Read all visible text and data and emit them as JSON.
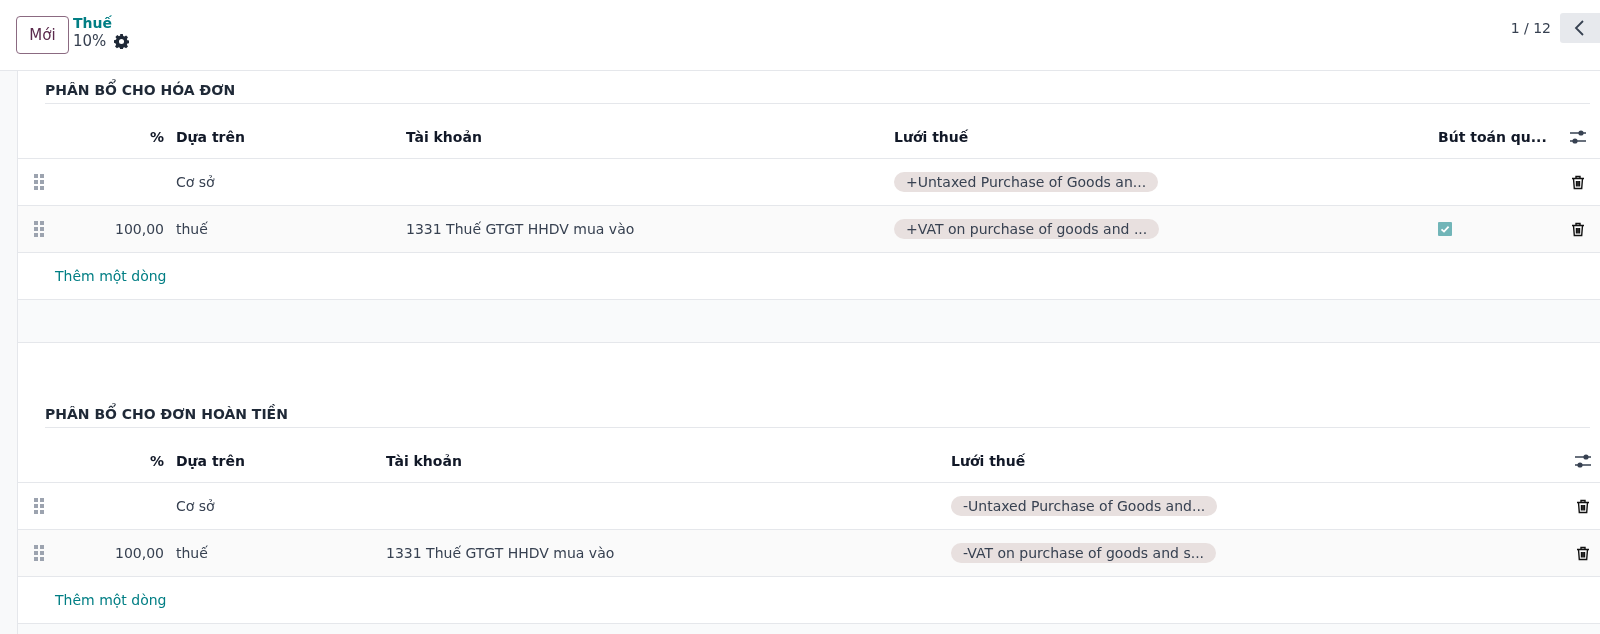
{
  "header": {
    "new_button": "Mới",
    "breadcrumb": "Thuế",
    "record_name": "10%",
    "pager": "1 / 12"
  },
  "sections": [
    {
      "title": "PHÂN BỔ CHO HÓA ĐƠN",
      "columns": [
        "%",
        "Dựa trên",
        "Tài khoản",
        "Lưới thuế",
        "Bút toán qu..."
      ],
      "rows": [
        {
          "based_on": "Cơ sở",
          "tax_grid": "+Untaxed Purchase of Goods an...",
          "checked": false
        },
        {
          "percent": "100,00",
          "based_on": "thuế",
          "account": "1331 Thuế GTGT HHDV mua vào",
          "tax_grid": "+VAT on purchase of goods and ...",
          "checked": true
        }
      ],
      "add_line": "Thêm một dòng"
    },
    {
      "title": "PHÂN BỔ CHO ĐƠN HOÀN TIỀN",
      "columns": [
        "%",
        "Dựa trên",
        "Tài khoản",
        "Lưới thuế"
      ],
      "rows": [
        {
          "based_on": "Cơ sở",
          "tax_grid": "-Untaxed Purchase of Goods and..."
        },
        {
          "percent": "100,00",
          "based_on": "thuế",
          "account": "1331 Thuế GTGT HHDV mua vào",
          "tax_grid": "-VAT on purchase of goods and s..."
        }
      ],
      "add_line": "Thêm một dòng"
    }
  ]
}
